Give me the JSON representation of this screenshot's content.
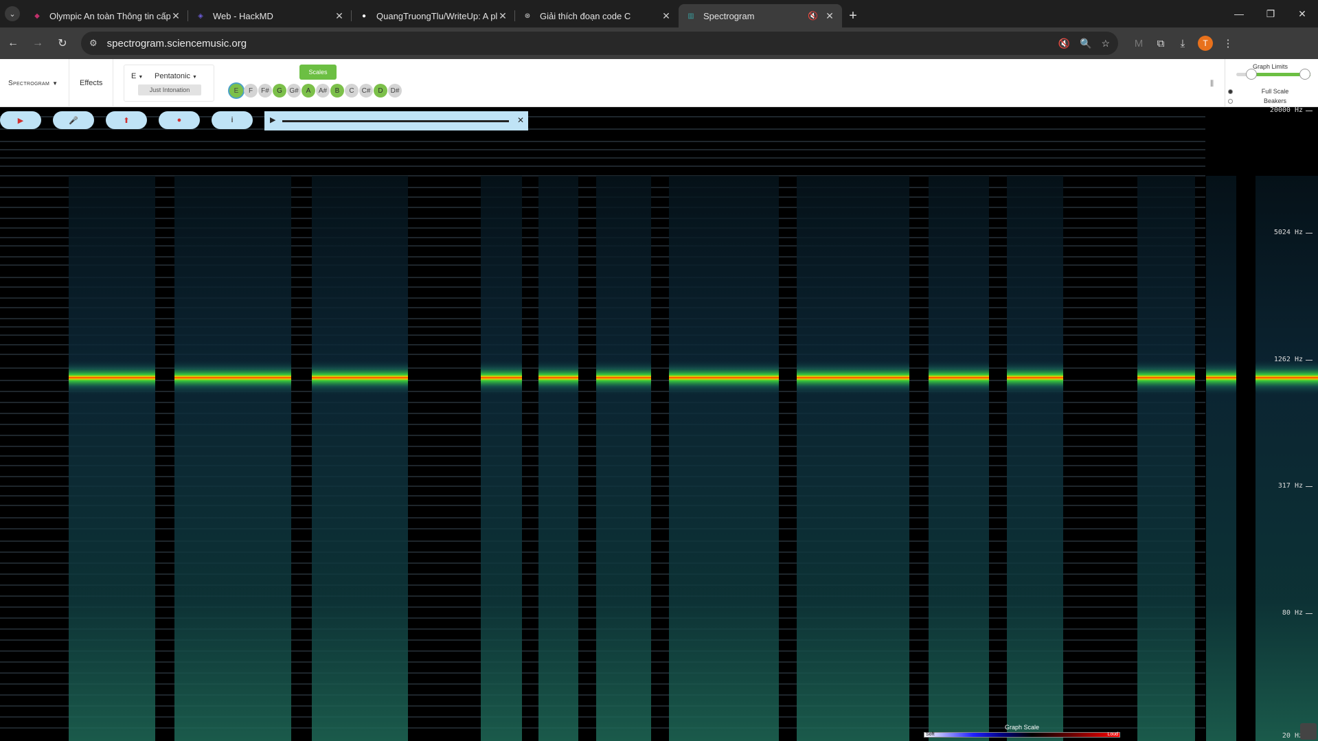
{
  "browser": {
    "tabs": [
      {
        "title": "Olympic An toàn Thông tin cấp",
        "active": false
      },
      {
        "title": "Web - HackMD",
        "active": false
      },
      {
        "title": "QuangTruongTlu/WriteUp: A pl",
        "active": false
      },
      {
        "title": "Giải thích đoạn code C",
        "active": false
      },
      {
        "title": "Spectrogram",
        "active": true
      }
    ],
    "url": "spectrogram.sciencemusic.org",
    "profile_initial": "T"
  },
  "app": {
    "brand": "Spectrogram",
    "effects": "Effects",
    "key": "E",
    "scale": "Pentatonic",
    "tuning": "Just Intonation",
    "scales_button": "Scales",
    "notes": [
      {
        "label": "E",
        "state": "root"
      },
      {
        "label": "F",
        "state": "off"
      },
      {
        "label": "F#",
        "state": "off"
      },
      {
        "label": "G",
        "state": "on"
      },
      {
        "label": "G#",
        "state": "off"
      },
      {
        "label": "A",
        "state": "on"
      },
      {
        "label": "A#",
        "state": "off"
      },
      {
        "label": "B",
        "state": "on"
      },
      {
        "label": "C",
        "state": "off"
      },
      {
        "label": "C#",
        "state": "off"
      },
      {
        "label": "D",
        "state": "on"
      },
      {
        "label": "D#",
        "state": "off"
      }
    ],
    "graph_limits": {
      "title": "Graph Limits",
      "options": [
        {
          "label": "Full Scale",
          "selected": true
        },
        {
          "label": "Beakers",
          "selected": false
        }
      ]
    }
  },
  "spectrogram": {
    "frequency_labels": [
      "20000 Hz",
      "5024 Hz",
      "1262 Hz",
      "317 Hz",
      "80 Hz",
      "20 Hz"
    ],
    "legend": {
      "title": "Graph Scale",
      "soft": "Soft",
      "loud": "Loud"
    },
    "colors": {
      "hot": "#ff2a00",
      "warm": "#f0d000",
      "mid": "#3ad23a",
      "cool": "#1a5a6a"
    }
  }
}
